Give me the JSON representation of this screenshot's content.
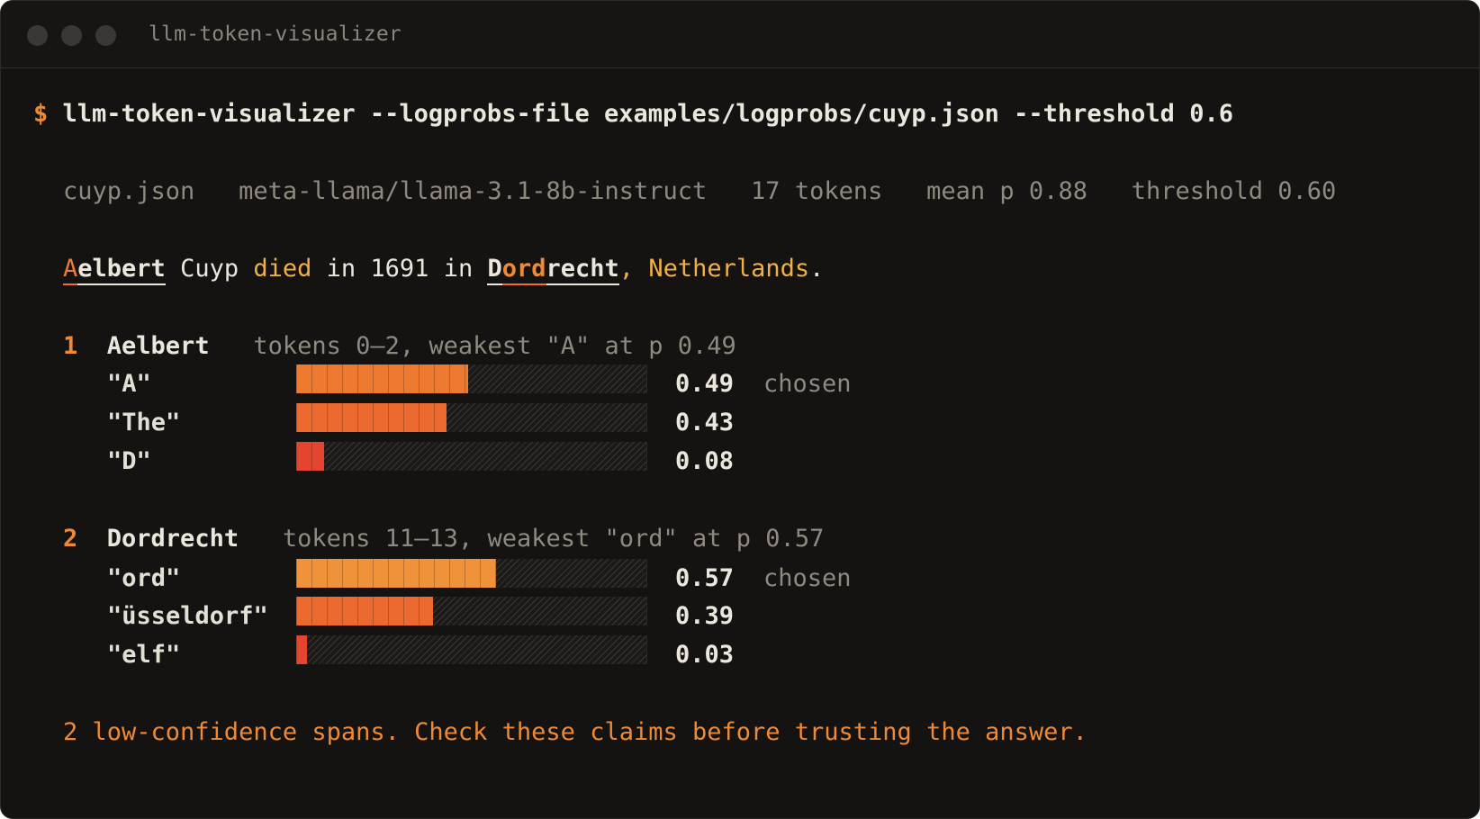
{
  "window": {
    "title": "llm-token-visualizer"
  },
  "command": {
    "prompt": "$",
    "text": "llm-token-visualizer --logprobs-file examples/logprobs/cuyp.json --threshold 0.6"
  },
  "summary": {
    "file": "cuyp.json",
    "model": "meta-llama/llama-3.1-8b-instruct",
    "tokens": "17 tokens",
    "mean": "mean p 0.88",
    "threshold": "threshold 0.60"
  },
  "sentence": {
    "t0": "A",
    "t1": "elbert",
    "t2": " Cuyp ",
    "t3": "died",
    "t4": " in 1691 in ",
    "t5": "D",
    "t6": "ord",
    "t7": "recht",
    "t8": ",",
    "t9": " Netherlands",
    "t10": "."
  },
  "spans": [
    {
      "index": "1",
      "word": "Aelbert",
      "detail": "tokens 0–2, weakest \"A\" at p 0.49",
      "candidates": [
        {
          "token": "\"A\"",
          "prob": 0.49,
          "prob_label": "0.49",
          "chosen": "chosen",
          "color": "#ee7a30"
        },
        {
          "token": "\"The\"",
          "prob": 0.43,
          "prob_label": "0.43",
          "chosen": "",
          "color": "#ec6a2f"
        },
        {
          "token": "\"D\"",
          "prob": 0.08,
          "prob_label": "0.08",
          "chosen": "",
          "color": "#e4452f"
        }
      ]
    },
    {
      "index": "2",
      "word": "Dordrecht",
      "detail": "tokens 11–13, weakest \"ord\" at p 0.57",
      "candidates": [
        {
          "token": "\"ord\"",
          "prob": 0.57,
          "prob_label": "0.57",
          "chosen": "chosen",
          "color": "#f0923a"
        },
        {
          "token": "\"üsseldorf\"",
          "prob": 0.39,
          "prob_label": "0.39",
          "chosen": "",
          "color": "#ec6a2f"
        },
        {
          "token": "\"elf\"",
          "prob": 0.03,
          "prob_label": "0.03",
          "chosen": "",
          "color": "#e4452f"
        }
      ]
    }
  ],
  "footer": "2 low-confidence spans. Check these claims before trusting the answer.",
  "colors": {
    "background": "#141312",
    "accent": "#ee8a35",
    "warning": "#efb049",
    "low": "#e4452f"
  }
}
